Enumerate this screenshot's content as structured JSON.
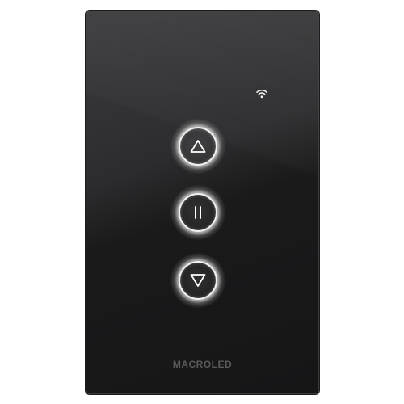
{
  "device": {
    "brand": "MACROLED",
    "status_icon": "wifi-icon",
    "buttons": [
      {
        "name": "up",
        "icon": "triangle-up-icon"
      },
      {
        "name": "pause",
        "icon": "pause-icon"
      },
      {
        "name": "down",
        "icon": "triangle-down-icon"
      }
    ],
    "colors": {
      "panel": "#1c1c1d",
      "glow": "#ffffff",
      "brand_text": "#5a5a5c"
    }
  }
}
